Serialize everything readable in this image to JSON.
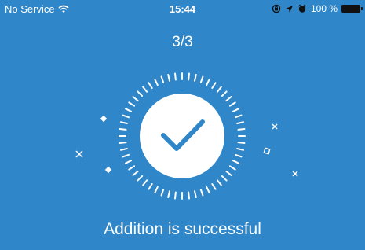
{
  "status_bar": {
    "carrier": "No Service",
    "time": "15:44",
    "battery_percent": "100 %",
    "icons": [
      "wifi-icon",
      "orientation-lock-icon",
      "location-icon",
      "alarm-icon",
      "battery-icon"
    ]
  },
  "header": {
    "step_text": "3/3"
  },
  "result": {
    "message": "Addition is successful",
    "icon": "checkmark-icon"
  },
  "colors": {
    "background": "#2f86c8",
    "foreground": "#ffffff",
    "accent": "#2f86c8"
  }
}
